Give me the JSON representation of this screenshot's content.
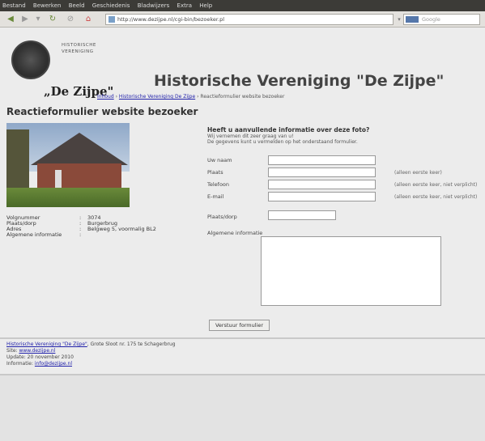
{
  "menu": [
    "Bestand",
    "Bewerken",
    "Beeld",
    "Geschiedenis",
    "Bladwijzers",
    "Extra",
    "Help"
  ],
  "nav": {
    "back": "◀",
    "forward": "▶",
    "reload": "↻",
    "stop": "⊘",
    "home": "⌂",
    "url": "http://www.dezijpe.nl/cgi-bin/bezoeker.pl",
    "search_placeholder": "Google"
  },
  "site": {
    "logo_text_1": "HISTORISCHE",
    "logo_text_2": "VERENIGING",
    "logo_name": "„De Zijpe\"",
    "title": "Historische Vereniging \"De Zijpe\"",
    "breadcrumb_home": "Inhoud",
    "breadcrumb_link": "Historische Vereniging De Zijpe",
    "breadcrumb_current": "› Reactieformulier website bezoeker"
  },
  "page": {
    "heading": "Reactieformulier website bezoeker",
    "info": [
      {
        "key": "Volgnummer",
        "value": "3074"
      },
      {
        "key": "Plaats/dorp",
        "value": "Burgerbrug"
      },
      {
        "key": "Adres",
        "value": "Belgweg 5, voormalig BL2"
      },
      {
        "key": "Algemene informatie",
        "value": ""
      }
    ]
  },
  "form": {
    "heading": "Heeft u aanvullende informatie over deze foto?",
    "intro_1": "Wij vernemen dit zeer graag van u!",
    "intro_2": "De gegevens kunt u vermelden op het onderstaand formulier.",
    "fields": [
      {
        "label": "Uw naam",
        "note": ""
      },
      {
        "label": "Plaats",
        "note": "(alleen eerste keer)"
      },
      {
        "label": "Telefoon",
        "note": "(alleen eerste keer, niet verplicht)"
      },
      {
        "label": "E-mail",
        "note": "(alleen eerste keer, niet verplicht)"
      }
    ],
    "place_label": "Plaats/dorp",
    "general_label": "Algemene informatie",
    "submit_label": "Verstuur formulier"
  },
  "footer": {
    "line1_link": "Historische Vereniging \"De Zijpe\"",
    "line1_rest": ", Grote Sloot nr. 175 te Schagerbrug",
    "line2_label": "Site: ",
    "line2_link": "www.dezijpe.nl",
    "line3": "Update: 20 november 2010",
    "line4_label": "Informatie: ",
    "line4_link": "info@dezijpe.nl"
  }
}
